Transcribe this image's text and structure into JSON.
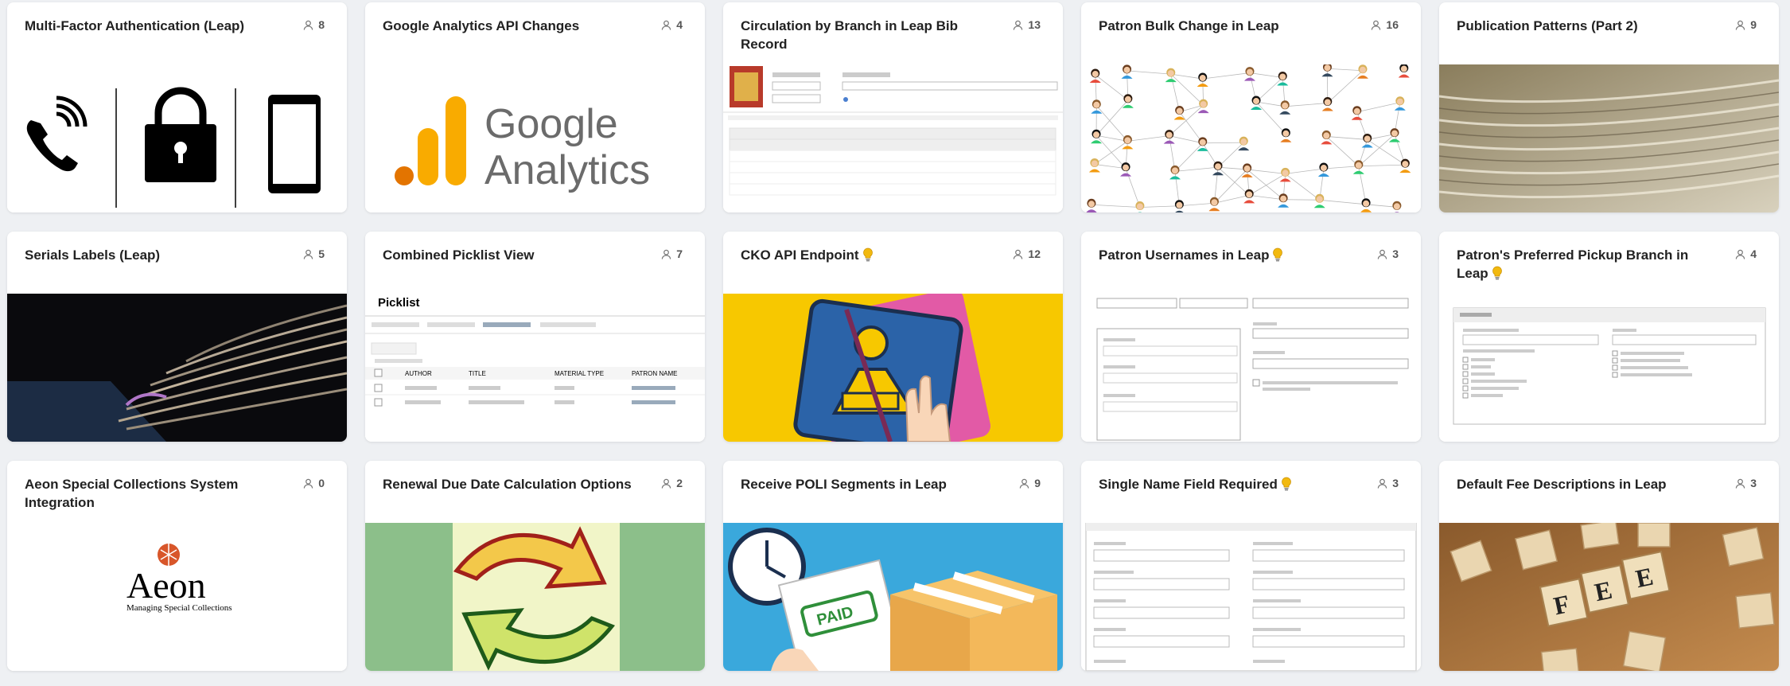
{
  "cards": [
    {
      "title": "Multi-Factor Authentication (Leap)",
      "count": "8",
      "bulb": false
    },
    {
      "title": "Google Analytics API Changes",
      "count": "4",
      "bulb": false
    },
    {
      "title": "Circulation by Branch in Leap Bib Record",
      "count": "13",
      "bulb": false
    },
    {
      "title": "Patron Bulk Change in Leap",
      "count": "16",
      "bulb": false
    },
    {
      "title": "Publication Patterns (Part 2)",
      "count": "9",
      "bulb": false
    },
    {
      "title": "Serials Labels (Leap)",
      "count": "5",
      "bulb": false
    },
    {
      "title": "Combined Picklist View",
      "count": "7",
      "bulb": false
    },
    {
      "title": "CKO API Endpoint",
      "count": "12",
      "bulb": true
    },
    {
      "title": "Patron Usernames in Leap",
      "count": "3",
      "bulb": true
    },
    {
      "title": "Patron's Preferred Pickup Branch in Leap",
      "count": "4",
      "bulb": true
    },
    {
      "title": "Aeon Special Collections System Integration",
      "count": "0",
      "bulb": false
    },
    {
      "title": "Renewal Due Date Calculation Options",
      "count": "2",
      "bulb": false
    },
    {
      "title": "Receive POLI Segments in Leap",
      "count": "9",
      "bulb": false
    },
    {
      "title": "Single Name Field Required",
      "count": "3",
      "bulb": true
    },
    {
      "title": "Default Fee Descriptions in Leap",
      "count": "3",
      "bulb": false
    }
  ],
  "thumbs": {
    "google_word1": "Google",
    "google_word2": "Analytics",
    "picklist_title": "Picklist",
    "picklist_cols": [
      "AUTHOR",
      "TITLE",
      "MATERIAL TYPE",
      "PATRON NAME"
    ],
    "aeon_name": "Aeon",
    "aeon_sub": "Managing Special Collections",
    "paid_label": "PAID",
    "fee_letters": [
      "F",
      "E",
      "E"
    ]
  },
  "colors": {
    "accent_yellow": "#f2b90f",
    "ga_orange": "#f9ab00",
    "ga_dark_orange": "#e37400",
    "cko_bg": "#f7c800",
    "poli_bg": "#3aa8dc",
    "renewal_bg": "#8cbf8a"
  }
}
